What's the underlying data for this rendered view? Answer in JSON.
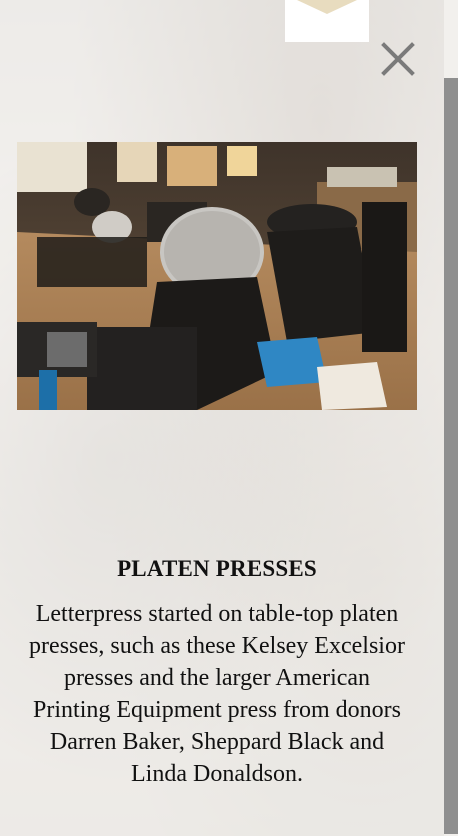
{
  "modal": {
    "title": "PLATEN PRESSES",
    "description": "Letterpress started on table-top platen presses, such as these Kelsey Excelsior presses and the larger American Printing Equipment press from donors Darren Baker, Sheppard Black and Linda Donaldson."
  },
  "icons": {
    "close": "close-icon",
    "logo": "logo-triangle-icon"
  },
  "colors": {
    "logo_fill": "#e8dcbf",
    "close_icon": "#7a7a7a",
    "scroll_thumb": "#8f8f8f"
  }
}
